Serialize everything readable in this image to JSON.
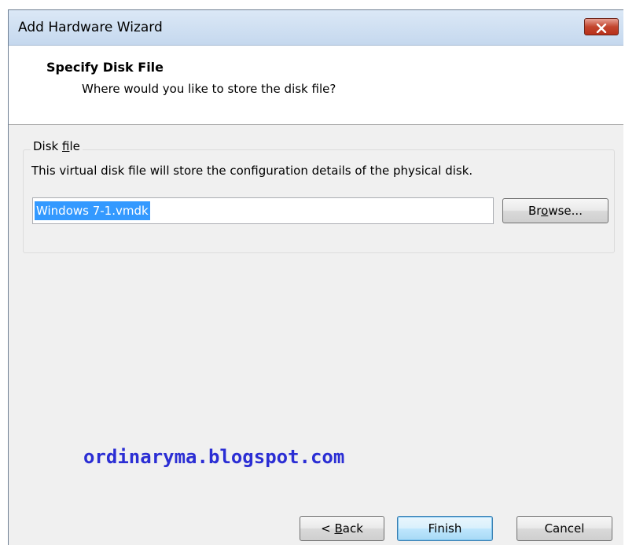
{
  "window": {
    "title": "Add Hardware Wizard",
    "close_icon": "close-x-icon"
  },
  "header": {
    "title": "Specify Disk File",
    "subtitle": "Where would you like to store the disk file?"
  },
  "disk_file_group": {
    "legend_prefix": "Disk ",
    "legend_accel": "f",
    "legend_suffix": "ile",
    "description": "This virtual disk file will store the configuration details of the physical disk.",
    "input_value": "Windows 7-1.vmdk",
    "browse_prefix": "Br",
    "browse_accel": "o",
    "browse_suffix": "wse..."
  },
  "footer": {
    "back_prefix": "< ",
    "back_accel": "B",
    "back_suffix": "ack",
    "finish_label": "Finish",
    "cancel_label": "Cancel"
  },
  "watermark": "ordinaryma.blogspot.com",
  "colors": {
    "selection": "#3399ff",
    "watermark": "#2b2ed4",
    "close_button": "#c3452e"
  }
}
